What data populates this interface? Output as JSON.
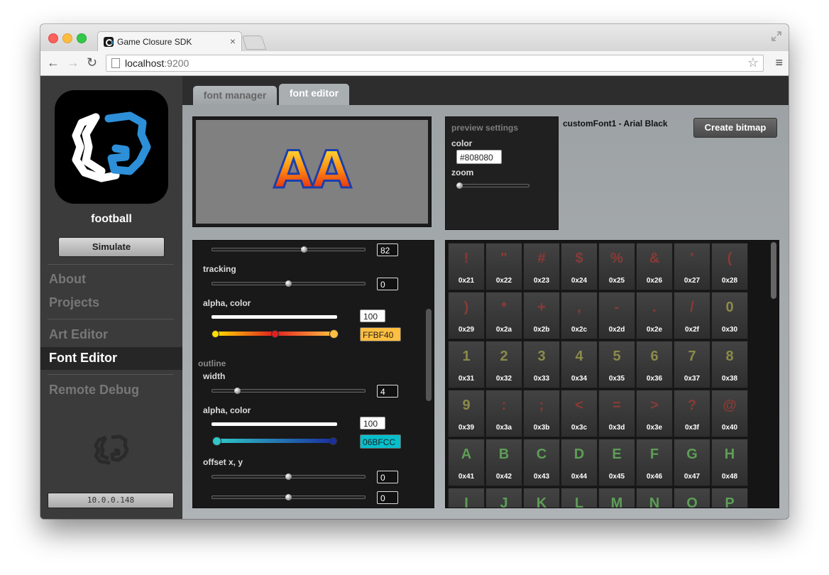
{
  "browser": {
    "tab_title": "Game Closure SDK",
    "tab_close": "×",
    "url_host": "localhost",
    "url_port": ":9200",
    "back_glyph": "←",
    "forward_glyph": "→",
    "reload_glyph": "↻",
    "star_glyph": "☆",
    "menu_glyph": "≡"
  },
  "sidebar": {
    "project_name": "football",
    "simulate_label": "Simulate",
    "nav": [
      "About",
      "Projects",
      "Art Editor",
      "Font Editor",
      "Remote Debug"
    ],
    "active_nav": "Font Editor",
    "ip_address": "10.0.0.148"
  },
  "editor_tabs": [
    "font manager",
    "font editor"
  ],
  "preview": {
    "sample_text": "AA"
  },
  "preview_settings": {
    "heading": "preview settings",
    "color_label": "color",
    "color_value": "#808080",
    "zoom_label": "zoom",
    "zoom_level": 0
  },
  "font_title": "customFont1 - Arial Black",
  "create_bitmap_label": "Create bitmap",
  "controls": {
    "size_value": "82",
    "tracking_label": "tracking",
    "tracking_value": "0",
    "fill_alpha_color_label": "alpha, color",
    "fill_alpha_value": "100",
    "fill_color_value": "FFBF40",
    "outline_label": "outline",
    "outline_width_label": "width",
    "outline_width_value": "4",
    "outline_alpha_color_label": "alpha, color",
    "outline_alpha_value": "100",
    "outline_color_value": "06BFCC",
    "offset_label": "offset x, y",
    "offset_x_value": "0",
    "offset_y_value": "0"
  },
  "colors": {
    "fill_color": "#FFBF40",
    "outline_color": "#06BFCC",
    "punct_glyph": "#8a3a36",
    "digit_glyph": "#8b8a4a",
    "letter_glyph": "#5d9e56"
  },
  "glyphs": [
    {
      "ch": "!",
      "hex": "0x21",
      "kind": "punct"
    },
    {
      "ch": "\"",
      "hex": "0x22",
      "kind": "punct"
    },
    {
      "ch": "#",
      "hex": "0x23",
      "kind": "punct"
    },
    {
      "ch": "$",
      "hex": "0x24",
      "kind": "punct"
    },
    {
      "ch": "%",
      "hex": "0x25",
      "kind": "punct"
    },
    {
      "ch": "&",
      "hex": "0x26",
      "kind": "punct"
    },
    {
      "ch": "'",
      "hex": "0x27",
      "kind": "punct"
    },
    {
      "ch": "(",
      "hex": "0x28",
      "kind": "punct"
    },
    {
      "ch": ")",
      "hex": "0x29",
      "kind": "punct"
    },
    {
      "ch": "*",
      "hex": "0x2a",
      "kind": "punct"
    },
    {
      "ch": "+",
      "hex": "0x2b",
      "kind": "punct"
    },
    {
      "ch": ",",
      "hex": "0x2c",
      "kind": "punct"
    },
    {
      "ch": "-",
      "hex": "0x2d",
      "kind": "punct"
    },
    {
      "ch": ".",
      "hex": "0x2e",
      "kind": "punct"
    },
    {
      "ch": "/",
      "hex": "0x2f",
      "kind": "punct"
    },
    {
      "ch": "0",
      "hex": "0x30",
      "kind": "digit"
    },
    {
      "ch": "1",
      "hex": "0x31",
      "kind": "digit"
    },
    {
      "ch": "2",
      "hex": "0x32",
      "kind": "digit"
    },
    {
      "ch": "3",
      "hex": "0x33",
      "kind": "digit"
    },
    {
      "ch": "4",
      "hex": "0x34",
      "kind": "digit"
    },
    {
      "ch": "5",
      "hex": "0x35",
      "kind": "digit"
    },
    {
      "ch": "6",
      "hex": "0x36",
      "kind": "digit"
    },
    {
      "ch": "7",
      "hex": "0x37",
      "kind": "digit"
    },
    {
      "ch": "8",
      "hex": "0x38",
      "kind": "digit"
    },
    {
      "ch": "9",
      "hex": "0x39",
      "kind": "digit"
    },
    {
      "ch": ":",
      "hex": "0x3a",
      "kind": "punct"
    },
    {
      "ch": ";",
      "hex": "0x3b",
      "kind": "punct"
    },
    {
      "ch": "<",
      "hex": "0x3c",
      "kind": "punct"
    },
    {
      "ch": "=",
      "hex": "0x3d",
      "kind": "punct"
    },
    {
      "ch": ">",
      "hex": "0x3e",
      "kind": "punct"
    },
    {
      "ch": "?",
      "hex": "0x3f",
      "kind": "punct"
    },
    {
      "ch": "@",
      "hex": "0x40",
      "kind": "punct"
    },
    {
      "ch": "A",
      "hex": "0x41",
      "kind": "letter"
    },
    {
      "ch": "B",
      "hex": "0x42",
      "kind": "letter"
    },
    {
      "ch": "C",
      "hex": "0x43",
      "kind": "letter"
    },
    {
      "ch": "D",
      "hex": "0x44",
      "kind": "letter"
    },
    {
      "ch": "E",
      "hex": "0x45",
      "kind": "letter"
    },
    {
      "ch": "F",
      "hex": "0x46",
      "kind": "letter"
    },
    {
      "ch": "G",
      "hex": "0x47",
      "kind": "letter"
    },
    {
      "ch": "H",
      "hex": "0x48",
      "kind": "letter"
    },
    {
      "ch": "I",
      "hex": "",
      "kind": "letter"
    },
    {
      "ch": "J",
      "hex": "",
      "kind": "letter"
    },
    {
      "ch": "K",
      "hex": "",
      "kind": "letter"
    },
    {
      "ch": "L",
      "hex": "",
      "kind": "letter"
    },
    {
      "ch": "M",
      "hex": "",
      "kind": "letter"
    },
    {
      "ch": "N",
      "hex": "",
      "kind": "letter"
    },
    {
      "ch": "O",
      "hex": "",
      "kind": "letter"
    },
    {
      "ch": "P",
      "hex": "",
      "kind": "letter"
    }
  ]
}
